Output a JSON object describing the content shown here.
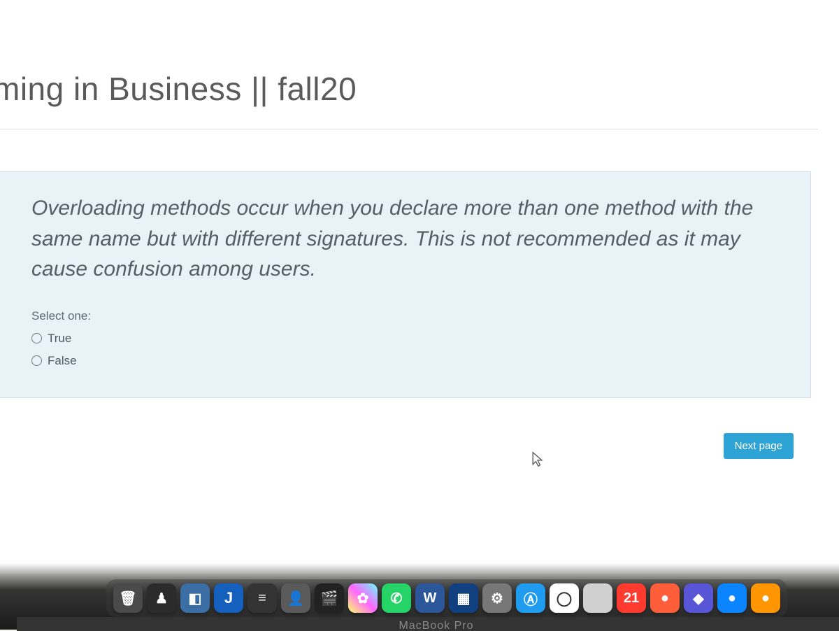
{
  "header": {
    "course_title": "ming in Business || fall20"
  },
  "question": {
    "text": "Overloading methods occur when you declare more than one method with the same name but with different signatures. This is not recommended as it may cause confusion among users.",
    "select_label": "Select one:",
    "options": [
      {
        "label": "True"
      },
      {
        "label": "False"
      }
    ]
  },
  "nav": {
    "next_label": "Next page"
  },
  "laptop": {
    "model": "MacBook Pro"
  },
  "colors": {
    "accent": "#2ea4d6",
    "question_bg": "#e9f3f7"
  }
}
